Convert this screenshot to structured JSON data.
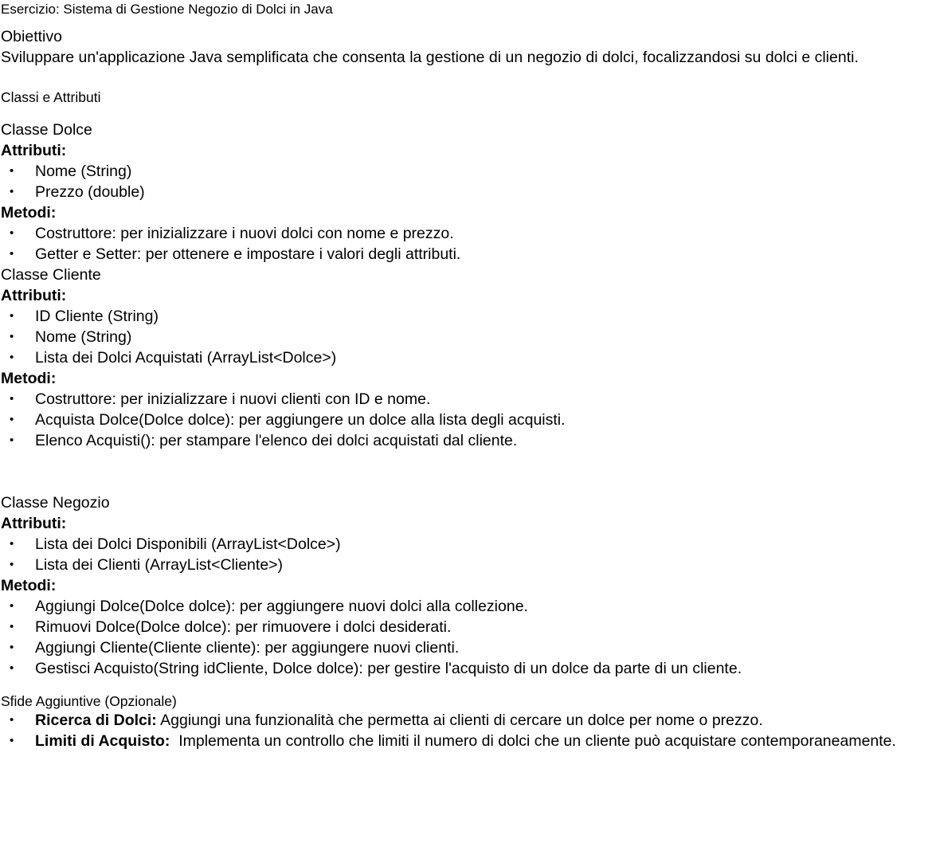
{
  "title": "Esercizio: Sistema di Gestione Negozio di Dolci in Java",
  "objective": {
    "heading": "Obiettivo",
    "text": "Sviluppare un'applicazione Java semplificata che consenta la gestione di un negozio di dolci, focalizzandosi su dolci e clienti."
  },
  "classes_heading": "Classi e Attributi",
  "bullet_glyph": "•",
  "dolce": {
    "heading": "Classe Dolce",
    "attributes_label": "Attributi:",
    "attributes": [
      "Nome (String)",
      "Prezzo (double)"
    ],
    "methods_label": "Metodi:",
    "methods": [
      "Costruttore: per inizializzare i nuovi dolci con nome e prezzo.",
      "Getter e Setter: per ottenere e impostare i valori degli attributi."
    ]
  },
  "cliente": {
    "heading": "Classe Cliente",
    "attributes_label": "Attributi:",
    "attributes": [
      "ID Cliente (String)",
      "Nome (String)",
      "Lista dei Dolci Acquistati (ArrayList<Dolce>)"
    ],
    "methods_label": "Metodi:",
    "methods": [
      "Costruttore: per inizializzare i nuovi clienti con ID e nome.",
      "Acquista Dolce(Dolce dolce): per aggiungere un dolce alla lista degli acquisti.",
      "Elenco Acquisti(): per stampare l'elenco dei dolci acquistati dal cliente."
    ]
  },
  "negozio": {
    "heading": "Classe Negozio",
    "attributes_label": "Attributi:",
    "attributes": [
      "Lista dei Dolci Disponibili (ArrayList<Dolce>)",
      "Lista dei Clienti (ArrayList<Cliente>)"
    ],
    "methods_label": "Metodi:",
    "methods": [
      "Aggiungi Dolce(Dolce dolce): per aggiungere nuovi dolci alla collezione.",
      "Rimuovi Dolce(Dolce dolce): per rimuovere i dolci desiderati.",
      "Aggiungi Cliente(Cliente cliente): per aggiungere nuovi clienti.",
      "Gestisci Acquisto(String idCliente, Dolce dolce): per gestire l'acquisto di un dolce da parte di un cliente."
    ]
  },
  "challenges": {
    "heading": "Sfide Aggiuntive (Opzionale)",
    "items": [
      {
        "label": "Ricerca di Dolci:",
        "text": " Aggiungi una funzionalità che permetta ai clienti di cercare un dolce per nome o prezzo."
      },
      {
        "label": "Limiti di Acquisto:",
        "text": "  Implementa un controllo che limiti il numero di dolci che un cliente può acquistare contemporaneamente."
      }
    ]
  }
}
